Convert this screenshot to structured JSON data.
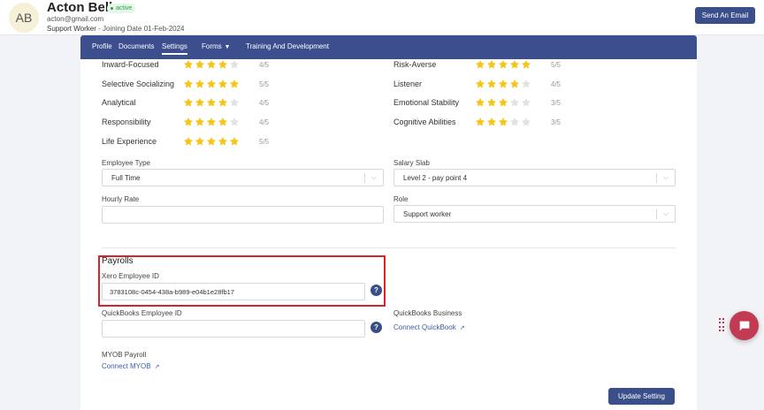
{
  "header": {
    "avatar_initials": "AB",
    "name": "Acton Bell",
    "status": "active",
    "email": "acton@gmail.com",
    "role": "Support Worker",
    "joining": "- Joining Date 01-Feb-2024",
    "send_email_label": "Send An Email"
  },
  "tabs": [
    {
      "label": "Profile"
    },
    {
      "label": "Documents"
    },
    {
      "label": "Settings",
      "active": true
    },
    {
      "label": "Forms"
    },
    {
      "label": "Training And Development"
    }
  ],
  "traits": [
    {
      "name": "Inward-Focused",
      "rating": 4,
      "score": "4/5"
    },
    {
      "name": "Selective Socializing",
      "rating": 5,
      "score": "5/5"
    },
    {
      "name": "Analytical",
      "rating": 4,
      "score": "4/5"
    },
    {
      "name": "Responsibility",
      "rating": 4,
      "score": "4/5"
    },
    {
      "name": "Life Experience",
      "rating": 5,
      "score": "5/5"
    },
    {
      "name": "Risk-Averse",
      "rating": 5,
      "score": "5/5"
    },
    {
      "name": "Listener",
      "rating": 4,
      "score": "4/5"
    },
    {
      "name": "Emotional Stability",
      "rating": 3,
      "score": "3/5"
    },
    {
      "name": "Cognitive Abilities",
      "rating": 3,
      "score": "3/5"
    }
  ],
  "form": {
    "employee_type_label": "Employee Type",
    "employee_type_value": "Full Time",
    "salary_slab_label": "Salary Slab",
    "salary_slab_value": "Level 2 - pay point 4",
    "hourly_rate_label": "Hourly Rate",
    "hourly_rate_value": "",
    "role_label": "Role",
    "role_value": "Support worker"
  },
  "payrolls": {
    "title": "Payrolls",
    "xero_label": "Xero Employee ID",
    "xero_value": "3783108c-0454-438a-b989-e04b1e28fb17",
    "quickbooks_label": "QuickBooks Employee ID",
    "quickbooks_value": "",
    "quickbooks_business_label": "QuickBooks Business",
    "connect_quickbook": "Connect QuickBook",
    "myob_label": "MYOB Payroll",
    "connect_myob": "Connect MYOB",
    "help_glyph": "?",
    "external_link_glyph": "↗"
  },
  "update_label": "Update Setting",
  "colors": {
    "star_filled": "#f5c518",
    "star_empty": "#e2e2e2",
    "primary": "#3a4f8a",
    "highlight": "#d0262d",
    "chat": "#c23b52"
  }
}
